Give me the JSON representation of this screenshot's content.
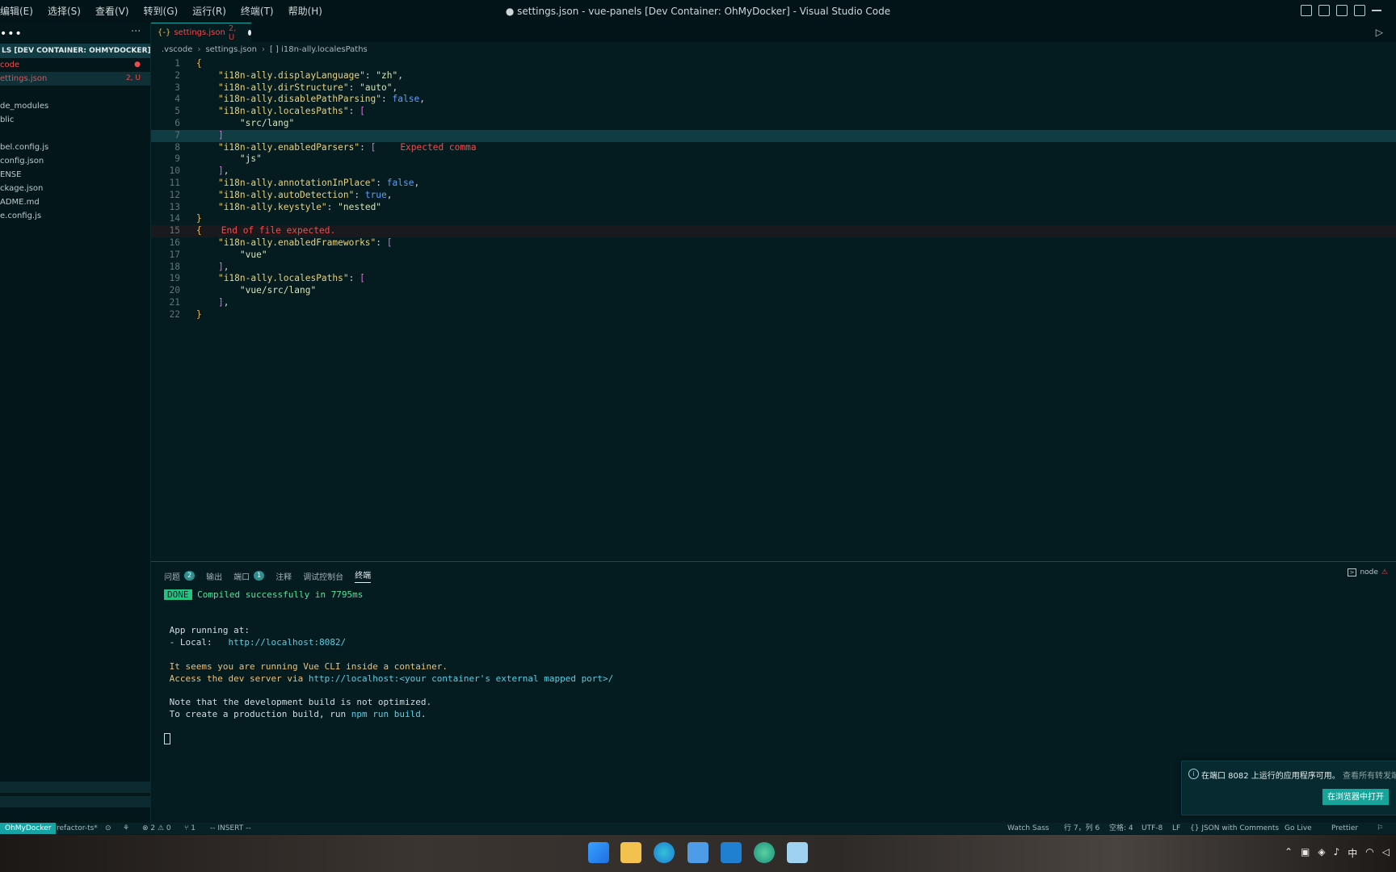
{
  "window": {
    "title": "● settings.json - vue-panels [Dev Container: OhMyDocker] - Visual Studio Code"
  },
  "menu": [
    "编辑(E)",
    "选择(S)",
    "查看(V)",
    "转到(G)",
    "运行(R)",
    "终端(T)",
    "帮助(H)"
  ],
  "sidebar": {
    "more": "···",
    "folder_header": "LS [DEV CONTAINER: OHMYDOCKER]",
    "items": [
      {
        "label": "code",
        "badge": "●",
        "color": "red"
      },
      {
        "label": "ettings.json",
        "badge": "2, U",
        "color": "red",
        "active": true
      },
      {
        "label": "",
        "badge": ""
      },
      {
        "label": "de_modules",
        "badge": ""
      },
      {
        "label": "blic",
        "badge": ""
      },
      {
        "label": "",
        "badge": ""
      },
      {
        "label": "bel.config.js",
        "badge": ""
      },
      {
        "label": "config.json",
        "badge": ""
      },
      {
        "label": "ENSE",
        "badge": ""
      },
      {
        "label": "ckage.json",
        "badge": ""
      },
      {
        "label": "ADME.md",
        "badge": ""
      },
      {
        "label": "e.config.js",
        "badge": ""
      }
    ]
  },
  "tab": {
    "icon": "{-}",
    "label": "settings.json",
    "status": "2, U"
  },
  "breadcrumb": {
    "part1": ".vscode",
    "part2": "settings.json",
    "part3": "[ ] i18n-ally.localesPaths"
  },
  "editor": {
    "lines": [
      {
        "n": "1",
        "html": "<span class='p'>{</span>"
      },
      {
        "n": "2",
        "html": "    <span class='k'>\"i18n-ally.displayLanguage\"</span><span class='w'>: </span><span class='s'>\"zh\"</span><span class='w'>,</span>"
      },
      {
        "n": "3",
        "html": "    <span class='k'>\"i18n-ally.dirStructure\"</span><span class='w'>: </span><span class='s'>\"auto\"</span><span class='w'>,</span>"
      },
      {
        "n": "4",
        "html": "    <span class='k'>\"i18n-ally.disablePathParsing\"</span><span class='w'>: </span><span class='b'>false</span><span class='w'>,</span>"
      },
      {
        "n": "5",
        "html": "    <span class='k'>\"i18n-ally.localesPaths\"</span><span class='w'>: </span><span class='br'>[</span>"
      },
      {
        "n": "6",
        "html": "        <span class='s'>\"src/lang\"</span>"
      },
      {
        "n": "7",
        "html": "    <span class='br'>]</span>",
        "cur": true
      },
      {
        "n": "8",
        "html": "    <span class='k'>\"i18n-ally.enabledParsers\"</span><span class='w'>: </span><span class='br'>[</span><span class='diag'>Expected comma</span>"
      },
      {
        "n": "9",
        "html": "        <span class='s'>\"js\"</span>"
      },
      {
        "n": "10",
        "html": "    <span class='br'>]</span><span class='w'>,</span>"
      },
      {
        "n": "11",
        "html": "    <span class='k'>\"i18n-ally.annotationInPlace\"</span><span class='w'>: </span><span class='b'>false</span><span class='w'>,</span>"
      },
      {
        "n": "12",
        "html": "    <span class='k'>\"i18n-ally.autoDetection\"</span><span class='w'>: </span><span class='b'>true</span><span class='w'>,</span>"
      },
      {
        "n": "13",
        "html": "    <span class='k'>\"i18n-ally.keystyle\"</span><span class='w'>: </span><span class='s'>\"nested\"</span>"
      },
      {
        "n": "14",
        "html": "<span class='p'>}</span>"
      },
      {
        "n": "15",
        "html": "<span class='p'>{</span><span class='diag' style='margin-left:24px'>End of file expected.</span>",
        "err": true
      },
      {
        "n": "16",
        "html": "    <span class='k'>\"i18n-ally.enabledFrameworks\"</span><span class='w'>: </span><span class='br'>[</span>"
      },
      {
        "n": "17",
        "html": "        <span class='s'>\"vue\"</span>"
      },
      {
        "n": "18",
        "html": "    <span class='br'>]</span><span class='w'>,</span>"
      },
      {
        "n": "19",
        "html": "    <span class='k'>\"i18n-ally.localesPaths\"</span><span class='w'>: </span><span class='br'>[</span>"
      },
      {
        "n": "20",
        "html": "        <span class='s'>\"vue/src/lang\"</span>"
      },
      {
        "n": "21",
        "html": "    <span class='br'>]</span><span class='w'>,</span>"
      },
      {
        "n": "22",
        "html": "<span class='p'>}</span>"
      }
    ]
  },
  "panel": {
    "tabs": [
      {
        "label": "问题",
        "count": "2"
      },
      {
        "label": "输出",
        "count": ""
      },
      {
        "label": "端口",
        "count": "1"
      },
      {
        "label": "注释",
        "count": ""
      },
      {
        "label": "调试控制台",
        "count": ""
      }
    ],
    "active_tab": "终端",
    "right_label": "node",
    "terminal": {
      "done": "DONE",
      "compiled": "Compiled successfully in 7795ms",
      "app_running": "App running at:",
      "local_label": "- Local:   ",
      "local_url": "http://localhost:8082/",
      "container_warn": "It seems you are running Vue CLI inside a container.",
      "access_prefix": "Access the dev server via ",
      "access_url": "http://localhost:<your container's external mapped port>/",
      "note": "Note that the development build is not optimized.",
      "prod_prefix": "To create a production build, run ",
      "prod_cmd": "npm run build",
      "prod_suffix": "."
    }
  },
  "notification": {
    "icon": "i",
    "text": "在端口 8082 上运行的应用程序可用。",
    "more": "查看所有转发端",
    "button": "在浏览器中打开"
  },
  "statusbar": {
    "remote": "OhMyDocker",
    "branch": "refactor-ts*",
    "problems": "⊗ 2 ⚠ 0",
    "ports": "⑂ 1",
    "mode": "-- INSERT --",
    "watch_sass": "Watch Sass",
    "position": "行 7，列 6",
    "spaces": "空格: 4",
    "encoding": "UTF-8",
    "eol": "LF",
    "language": "{} JSON with Comments",
    "go_live": "Go Live",
    "prettier": "Prettier"
  },
  "tray": {
    "ime": "中"
  },
  "colors": {
    "accent": "#16a3a3",
    "error": "#f14c4c",
    "editor_bg": "#041b1f"
  }
}
